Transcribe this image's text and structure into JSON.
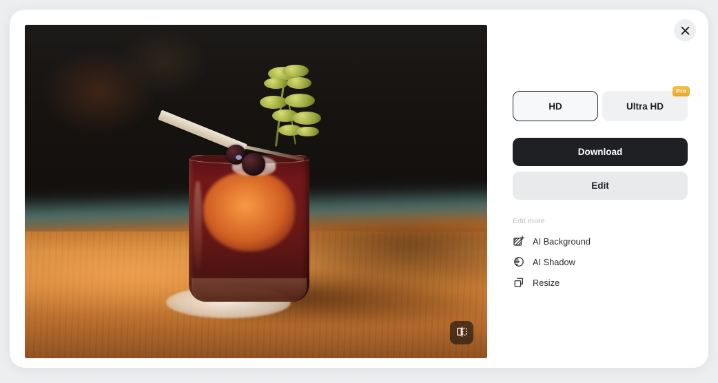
{
  "modal": {
    "close_icon": "close-icon"
  },
  "preview": {
    "alt": "Cocktail in a rocks glass with orange ice, herb sprig and cherry garnish on a wooden table",
    "compare_icon": "compare-split-icon"
  },
  "panel": {
    "quality_options": [
      {
        "label": "HD",
        "selected": true,
        "badge": null
      },
      {
        "label": "Ultra HD",
        "selected": false,
        "badge": "Pro"
      }
    ],
    "download_label": "Download",
    "edit_label": "Edit",
    "edit_more_label": "Edit more",
    "edit_more_items": [
      {
        "label": "AI Background",
        "icon": "ai-background-icon"
      },
      {
        "label": "AI Shadow",
        "icon": "ai-shadow-icon"
      },
      {
        "label": "Resize",
        "icon": "resize-icon"
      }
    ]
  },
  "colors": {
    "page_background": "#eceef0",
    "modal_background": "#ffffff",
    "primary_button": "#1f2024",
    "secondary_button": "#e9eaec",
    "quality_button": "#f4f5f6",
    "pro_badge": "#e9a528",
    "muted_text": "#b7bbc1"
  }
}
